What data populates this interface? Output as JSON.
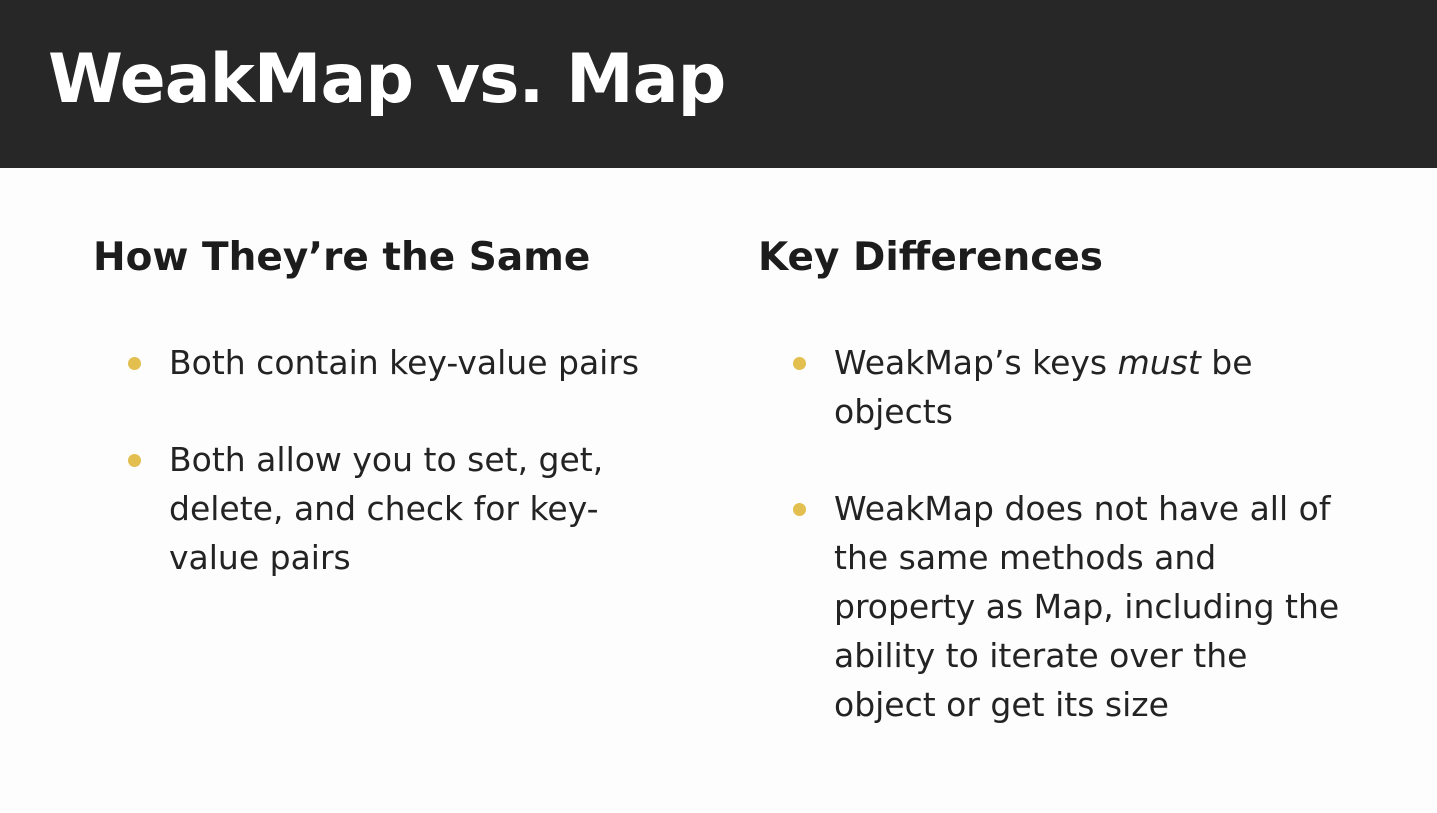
{
  "slide": {
    "title": "WeakMap vs. Map"
  },
  "left_column": {
    "heading": "How They’re the Same",
    "bullets": [
      "Both contain key-value pairs",
      "Both allow you to set, get, delete, and check for key-value pairs"
    ]
  },
  "right_column": {
    "heading": "Key Differences",
    "bullets": [
      {
        "before": "WeakMap’s keys ",
        "emphasis": "must",
        "after": " be objects"
      },
      "WeakMap does not have all of the same methods and property as Map, including the ability to iterate over the object or get its size"
    ]
  },
  "colors": {
    "title_bar": "#272727",
    "title_text": "#ffffff",
    "bullet_accent": "#e2bf4f",
    "body_background": "#fdfdfd"
  }
}
